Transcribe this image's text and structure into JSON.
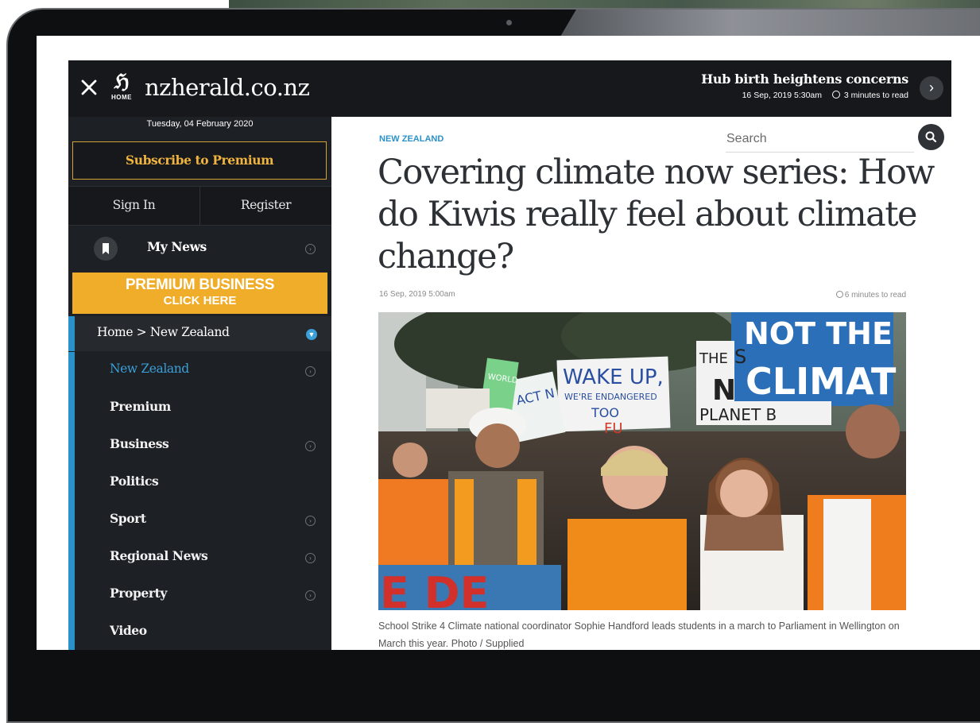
{
  "header": {
    "site_name": "nzherald.co.nz",
    "logo_glyph": "ℌ",
    "logo_label": "HOME",
    "promo": {
      "title": "Hub birth heightens concerns",
      "date": "16 Sep, 2019 5:30am",
      "read_time": "3 minutes to read"
    }
  },
  "sidebar": {
    "date": "Tuesday, 04 February 2020",
    "subscribe_label": "Subscribe to Premium",
    "sign_in_label": "Sign In",
    "register_label": "Register",
    "my_news_label": "My News",
    "premium_banner": {
      "line1": "PREMIUM BUSINESS",
      "line2": "CLICK HERE"
    },
    "breadcrumb": "Home > New Zealand",
    "items": [
      {
        "label": "New Zealand",
        "active": true,
        "has_submenu": true
      },
      {
        "label": "Premium",
        "active": false,
        "has_submenu": false
      },
      {
        "label": "Business",
        "active": false,
        "has_submenu": true
      },
      {
        "label": "Politics",
        "active": false,
        "has_submenu": false
      },
      {
        "label": "Sport",
        "active": false,
        "has_submenu": true
      },
      {
        "label": "Regional News",
        "active": false,
        "has_submenu": true
      },
      {
        "label": "Property",
        "active": false,
        "has_submenu": true
      },
      {
        "label": "Video",
        "active": false,
        "has_submenu": false
      }
    ]
  },
  "article": {
    "section": "NEW ZEALAND",
    "search_placeholder": "Search",
    "headline": "Covering climate now series: How do Kiwis really feel about climate change?",
    "date": "16 Sep, 2019 5:00am",
    "read_time": "6 minutes to read",
    "photo": {
      "signs": [
        "NOT THE",
        "CLIMAT",
        "WAKE UP,",
        "WE'RE ENDANGERED",
        "TOO",
        "FU",
        "THE",
        "N",
        "PLANET B",
        "S",
        "ACT N",
        "WORLD",
        "E DE"
      ]
    },
    "caption": "School Strike 4 Climate national coordinator Sophie Handford leads students in a march to Parliament in Wellington on March this year. Photo / Supplied"
  },
  "colors": {
    "header_bg": "#16181b",
    "sidebar_bg": "#1d2024",
    "accent_blue": "#2a91c9",
    "premium_orange": "#f0ad2a",
    "subscribe_gold": "#f0b43e"
  }
}
